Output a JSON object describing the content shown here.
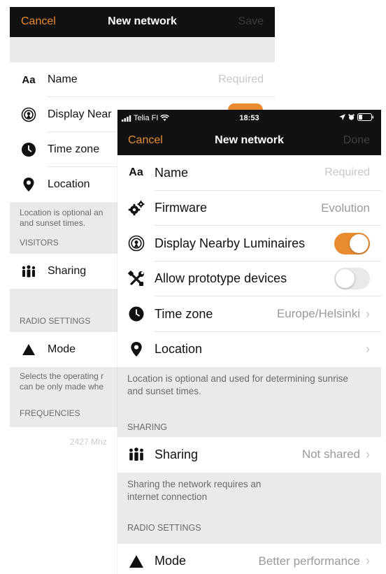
{
  "back": {
    "nav": {
      "cancel": "Cancel",
      "title": "New network",
      "save": "Save"
    },
    "rows": [
      {
        "icon": "aa-icon",
        "label": "Name",
        "value": "Required"
      },
      {
        "icon": "broadcast-icon",
        "label": "Display Near"
      },
      {
        "icon": "clock-icon",
        "label": "Time zone"
      },
      {
        "icon": "location-pin-icon",
        "label": "Location"
      }
    ],
    "location_note": "Location is optional an\nand sunset times.",
    "visitors_header": "VISITORS",
    "sharing_label": "Sharing",
    "radio_header": "RADIO SETTINGS",
    "mode_label": "Mode",
    "mode_note": "Selects the operating r\ncan be only made whe",
    "frequencies_header": "FREQUENCIES",
    "frequency_peek": "2427 Mhz"
  },
  "front": {
    "status": {
      "carrier": "Telia FI",
      "time": "18:53"
    },
    "nav": {
      "cancel": "Cancel",
      "title": "New network",
      "done": "Done"
    },
    "rows": {
      "name": {
        "label": "Name",
        "placeholder": "Required"
      },
      "firmware": {
        "label": "Firmware",
        "value": "Evolution"
      },
      "display_nearby": {
        "label": "Display Nearby Luminaires",
        "on": true
      },
      "prototype": {
        "label": "Allow prototype devices",
        "on": false
      },
      "timezone": {
        "label": "Time zone",
        "value": "Europe/Helsinki"
      },
      "location": {
        "label": "Location",
        "value": ""
      }
    },
    "location_note": "Location is optional and used for determining sunrise and sunset times.",
    "sharing_header": "SHARING",
    "sharing": {
      "label": "Sharing",
      "value": "Not shared"
    },
    "sharing_note": "Sharing the network requires an internet connection",
    "radio_header": "RADIO SETTINGS",
    "mode": {
      "label": "Mode",
      "value": "Better performance"
    },
    "accent": "#e98b2f"
  }
}
